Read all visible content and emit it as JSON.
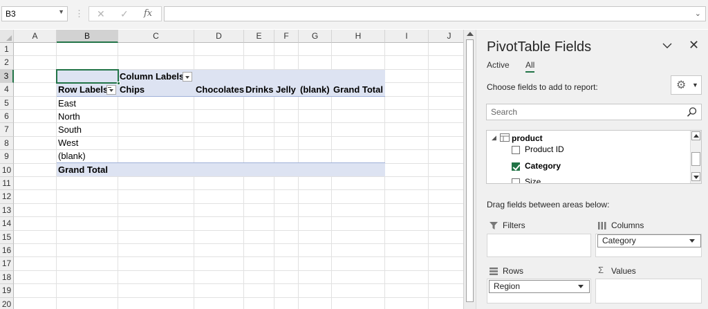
{
  "formula_bar": {
    "name_box": "B3",
    "cancel_glyph": "✕",
    "enter_glyph": "✓",
    "fx_glyph": "fx",
    "formula": ""
  },
  "sheet": {
    "columns": [
      "A",
      "B",
      "C",
      "D",
      "E",
      "F",
      "G",
      "H",
      "I",
      "J"
    ],
    "rows": [
      "1",
      "2",
      "3",
      "4",
      "5",
      "6",
      "7",
      "8",
      "9",
      "10",
      "11",
      "12",
      "13",
      "14",
      "15",
      "16",
      "17",
      "18",
      "19",
      "20"
    ],
    "selected_column": "B",
    "selected_row": "3"
  },
  "pivot": {
    "column_labels": "Column Labels",
    "row_labels": "Row Labels",
    "columns": [
      "Chips",
      "Chocolates",
      "Drinks",
      "Jelly",
      "(blank)",
      "Grand Total"
    ],
    "rows": [
      "East",
      "North",
      "South",
      "West",
      "(blank)"
    ],
    "grand_total": "Grand Total"
  },
  "pane": {
    "title": "PivotTable Fields",
    "tabs": [
      "Active",
      "All"
    ],
    "active_tab": "All",
    "choose_label": "Choose fields to add to report:",
    "search_placeholder": "Search",
    "table_name": "product",
    "fields": [
      {
        "label": "Product ID",
        "checked": false
      },
      {
        "label": "Category",
        "checked": true
      },
      {
        "label": "Size",
        "checked": false
      }
    ],
    "drag_label": "Drag fields between areas below:",
    "areas": {
      "filters": {
        "title": "Filters",
        "items": []
      },
      "columns": {
        "title": "Columns",
        "items": [
          "Category"
        ]
      },
      "rows": {
        "title": "Rows",
        "items": [
          "Region"
        ]
      },
      "values": {
        "title": "Values",
        "items": []
      }
    }
  },
  "colors": {
    "accent_green": "#217346",
    "pivot_header_band": "#dde3f2",
    "pane_background": "#f0f0f0"
  }
}
